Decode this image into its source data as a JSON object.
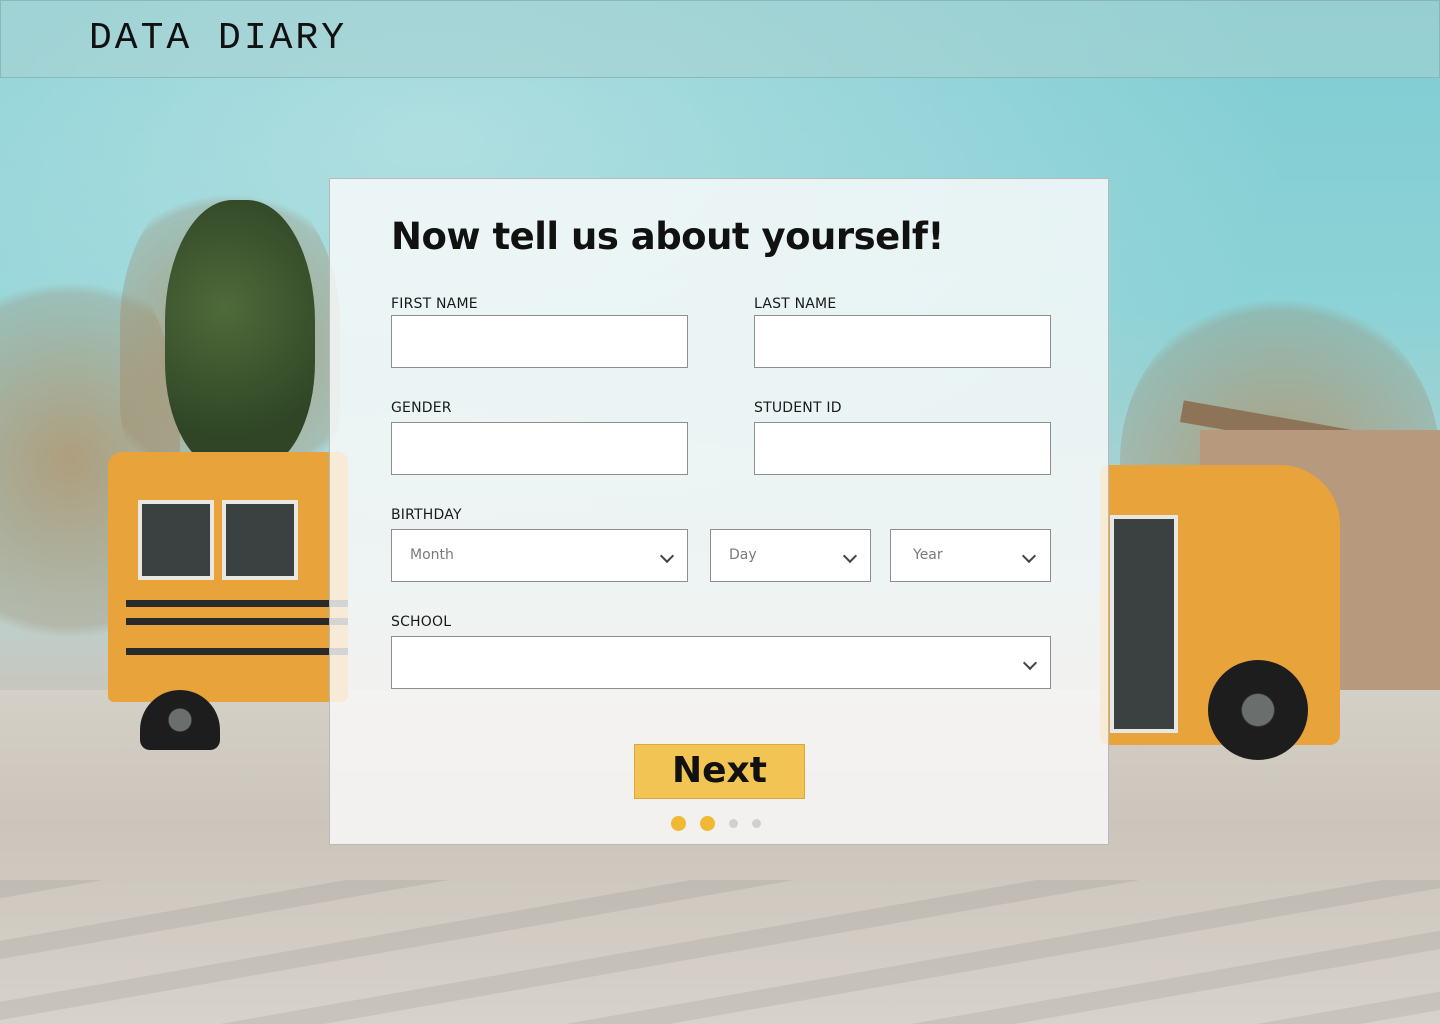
{
  "app": {
    "brand": "DATA DIARY"
  },
  "form": {
    "heading": "Now tell us about yourself!",
    "first_name": {
      "label": "FIRST NAME",
      "value": ""
    },
    "last_name": {
      "label": "LAST NAME",
      "value": ""
    },
    "gender": {
      "label": "GENDER",
      "value": ""
    },
    "student_id": {
      "label": "STUDENT ID",
      "value": ""
    },
    "birthday": {
      "label": "BIRTHDAY",
      "month_placeholder": "Month",
      "day_placeholder": "Day",
      "year_placeholder": "Year"
    },
    "school": {
      "label": "SCHOOL",
      "value": ""
    },
    "next_label": "Next",
    "progress": {
      "total_steps": 4,
      "current_step": 2
    }
  },
  "colors": {
    "accent": "#f2c453",
    "progress_active": "#f0b833",
    "progress_inactive": "#d0d0d0"
  },
  "icons": {
    "select": "chevron-down-icon"
  }
}
